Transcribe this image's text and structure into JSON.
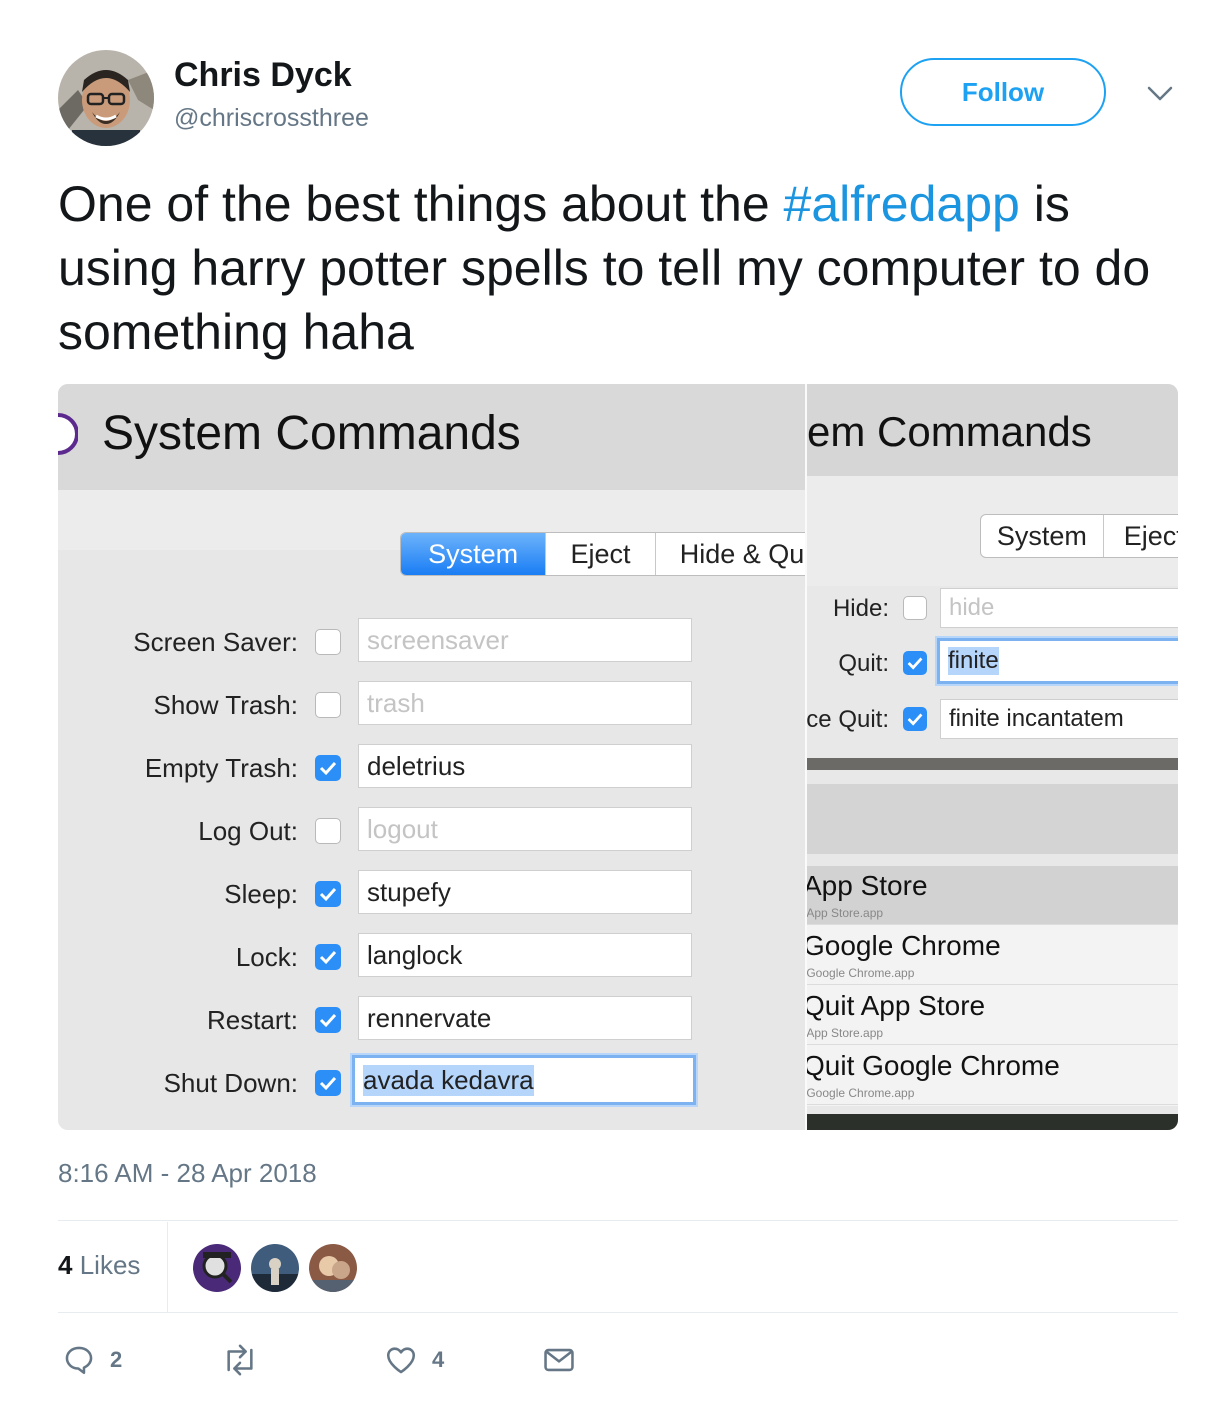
{
  "author": {
    "name": "Chris Dyck",
    "handle": "@chriscrossthree"
  },
  "follow_label": "Follow",
  "tweet": {
    "text_before": "One of the best things about the ",
    "hashtag": "#alfredapp",
    "text_after": " is using harry potter spells to tell my computer to do something haha"
  },
  "screenshot_left": {
    "title": "System Commands",
    "tabs": [
      "System",
      "Eject",
      "Hide & Qu"
    ],
    "active_tab": "System",
    "rows": [
      {
        "label": "Screen Saver:",
        "checked": false,
        "value": "screensaver"
      },
      {
        "label": "Show Trash:",
        "checked": false,
        "value": "trash"
      },
      {
        "label": "Empty Trash:",
        "checked": true,
        "value": "deletrius"
      },
      {
        "label": "Log Out:",
        "checked": false,
        "value": "logout"
      },
      {
        "label": "Sleep:",
        "checked": true,
        "value": "stupefy"
      },
      {
        "label": "Lock:",
        "checked": true,
        "value": "langlock"
      },
      {
        "label": "Restart:",
        "checked": true,
        "value": "rennervate"
      },
      {
        "label": "Shut Down:",
        "checked": true,
        "value": "avada kedavra"
      }
    ]
  },
  "screenshot_right": {
    "title": "em Commands",
    "tabs": [
      "System",
      "Eject"
    ],
    "rows": [
      {
        "label": "Hide:",
        "checked": false,
        "value": "hide"
      },
      {
        "label": "Quit:",
        "checked": true,
        "value": "finite"
      },
      {
        "label": "ce Quit:",
        "checked": true,
        "value": "finite incantatem"
      }
    ],
    "results": [
      {
        "title": "App Store",
        "subtitle": "/App Store.app"
      },
      {
        "title": "Google Chrome",
        "subtitle": "/Google Chrome.app"
      },
      {
        "title": "Quit App Store",
        "subtitle": "/App Store.app"
      },
      {
        "title": "Quit Google Chrome",
        "subtitle": "/Google Chrome.app"
      }
    ]
  },
  "timestamp": "8:16 AM - 28 Apr 2018",
  "likes": {
    "count": "4",
    "label": "Likes"
  },
  "actions": {
    "replies": "2",
    "retweets": "",
    "likes": "4"
  },
  "colors": {
    "link": "#1b95e0",
    "follow": "#1da1f2",
    "meta": "#657786",
    "checkbox": "#2b8ff7"
  },
  "icons": [
    "chevron-down-icon",
    "reply-icon",
    "retweet-icon",
    "heart-icon",
    "message-icon"
  ]
}
